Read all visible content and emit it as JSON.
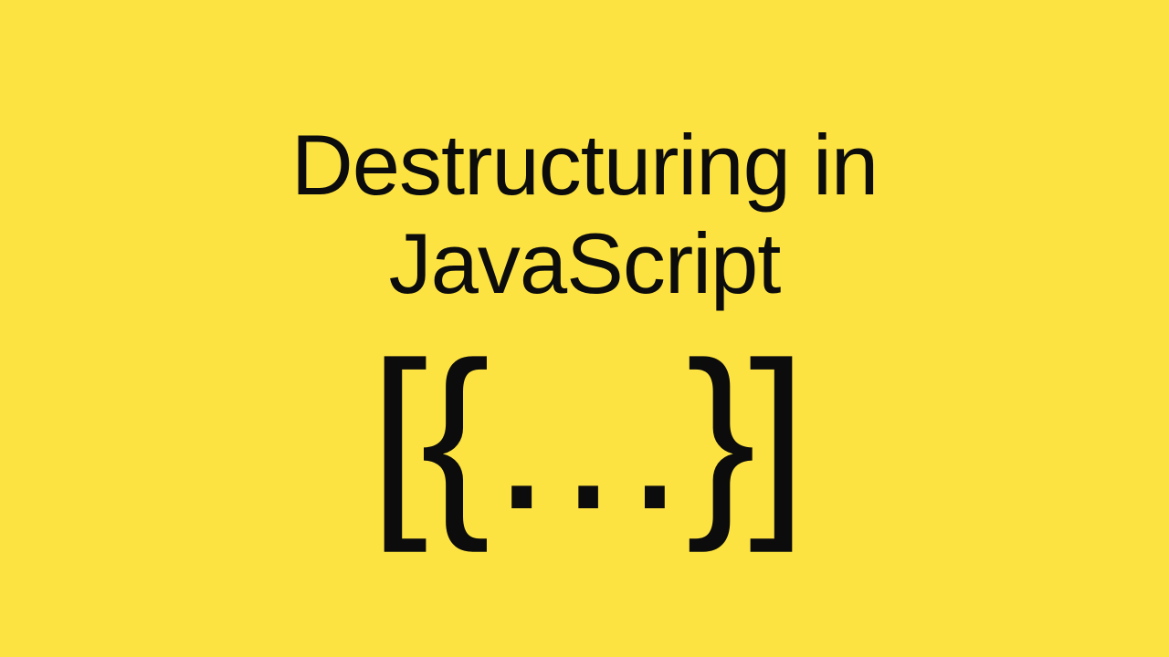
{
  "title_line1": "Destructuring in",
  "title_line2": "JavaScript",
  "brackets_symbol": "[{…}]"
}
